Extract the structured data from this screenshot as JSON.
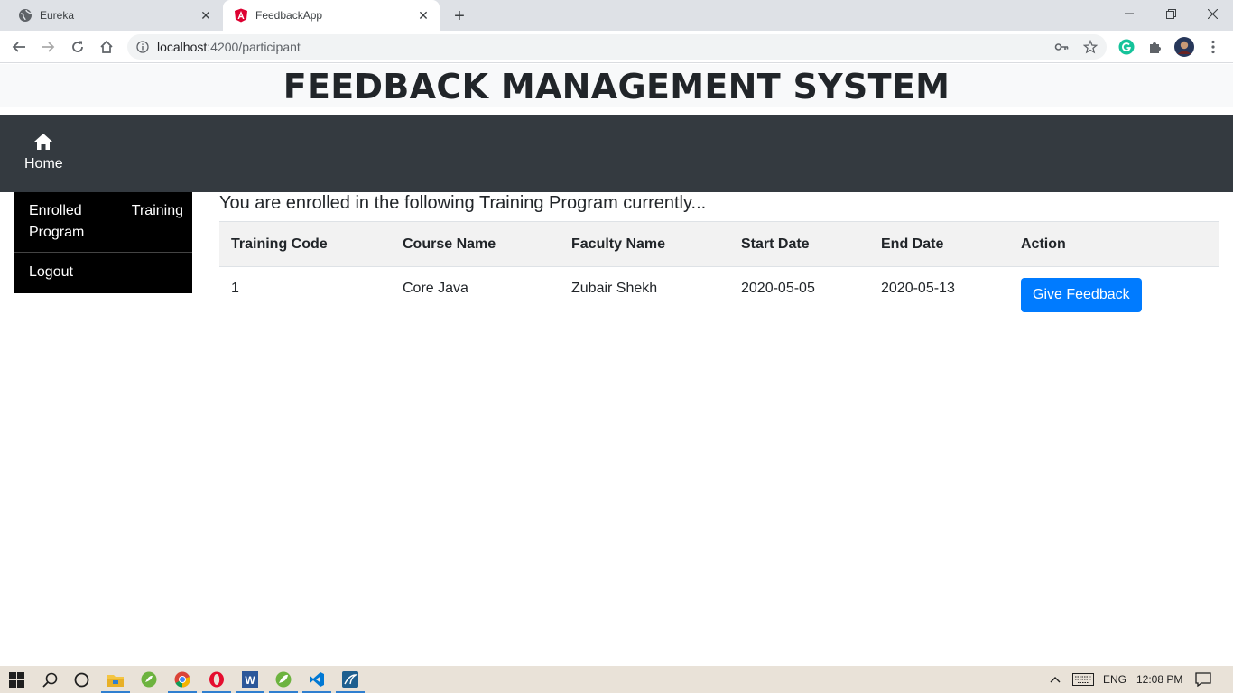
{
  "browser": {
    "tabs": [
      {
        "title": "Eureka",
        "favicon": "globe-icon"
      },
      {
        "title": "FeedbackApp",
        "favicon": "angular-icon"
      }
    ],
    "address": {
      "host": "localhost",
      "path": ":4200/participant"
    }
  },
  "header": {
    "title": "FEEDBACK MANAGEMENT SYSTEM"
  },
  "navbar": {
    "home_label": "Home"
  },
  "sidebar": {
    "items": [
      {
        "label": "Enrolled Training Program"
      },
      {
        "label": "Logout"
      }
    ]
  },
  "main": {
    "intro": "You are enrolled in the following Training Program currently...",
    "table": {
      "headers": [
        "Training Code",
        "Course Name",
        "Faculty Name",
        "Start Date",
        "End Date",
        "Action"
      ],
      "rows": [
        {
          "code": "1",
          "course": "Core Java",
          "faculty": "Zubair Shekh",
          "start": "2020-05-05",
          "end": "2020-05-13",
          "action": "Give Feedback"
        }
      ]
    }
  },
  "taskbar": {
    "language": "ENG",
    "time": "12:08 PM"
  },
  "colors": {
    "navbar_bg": "#343a40",
    "sidebar_bg": "#000000",
    "primary_button": "#007bff",
    "banner_bg": "#f8f9fa"
  }
}
